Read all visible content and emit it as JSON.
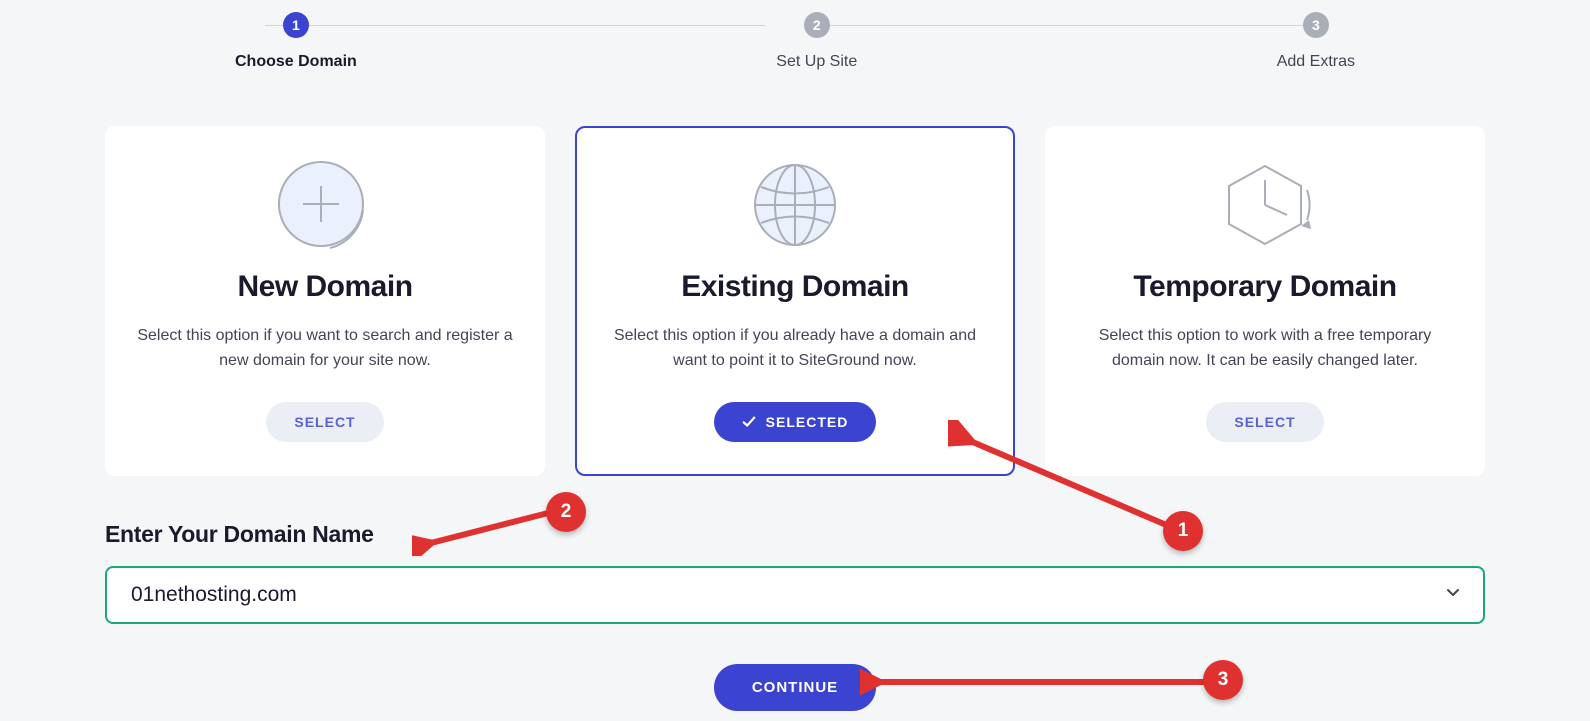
{
  "stepper": {
    "steps": [
      {
        "num": "1",
        "label": "Choose Domain",
        "active": true
      },
      {
        "num": "2",
        "label": "Set Up Site",
        "active": false
      },
      {
        "num": "3",
        "label": "Add Extras",
        "active": false
      }
    ]
  },
  "cards": {
    "new_domain": {
      "title": "New Domain",
      "desc": "Select this option if you want to search and register a new domain for your site now.",
      "button": "SELECT"
    },
    "existing_domain": {
      "title": "Existing Domain",
      "desc": "Select this option if you already have a domain and want to point it to SiteGround now.",
      "button": "SELECTED"
    },
    "temporary_domain": {
      "title": "Temporary Domain",
      "desc": "Select this option to work with a free temporary domain now. It can be easily changed later.",
      "button": "SELECT"
    }
  },
  "domain_section": {
    "heading": "Enter Your Domain Name",
    "value": "01nethosting.com"
  },
  "continue_label": "CONTINUE",
  "callouts": {
    "one": "1",
    "two": "2",
    "three": "3"
  }
}
